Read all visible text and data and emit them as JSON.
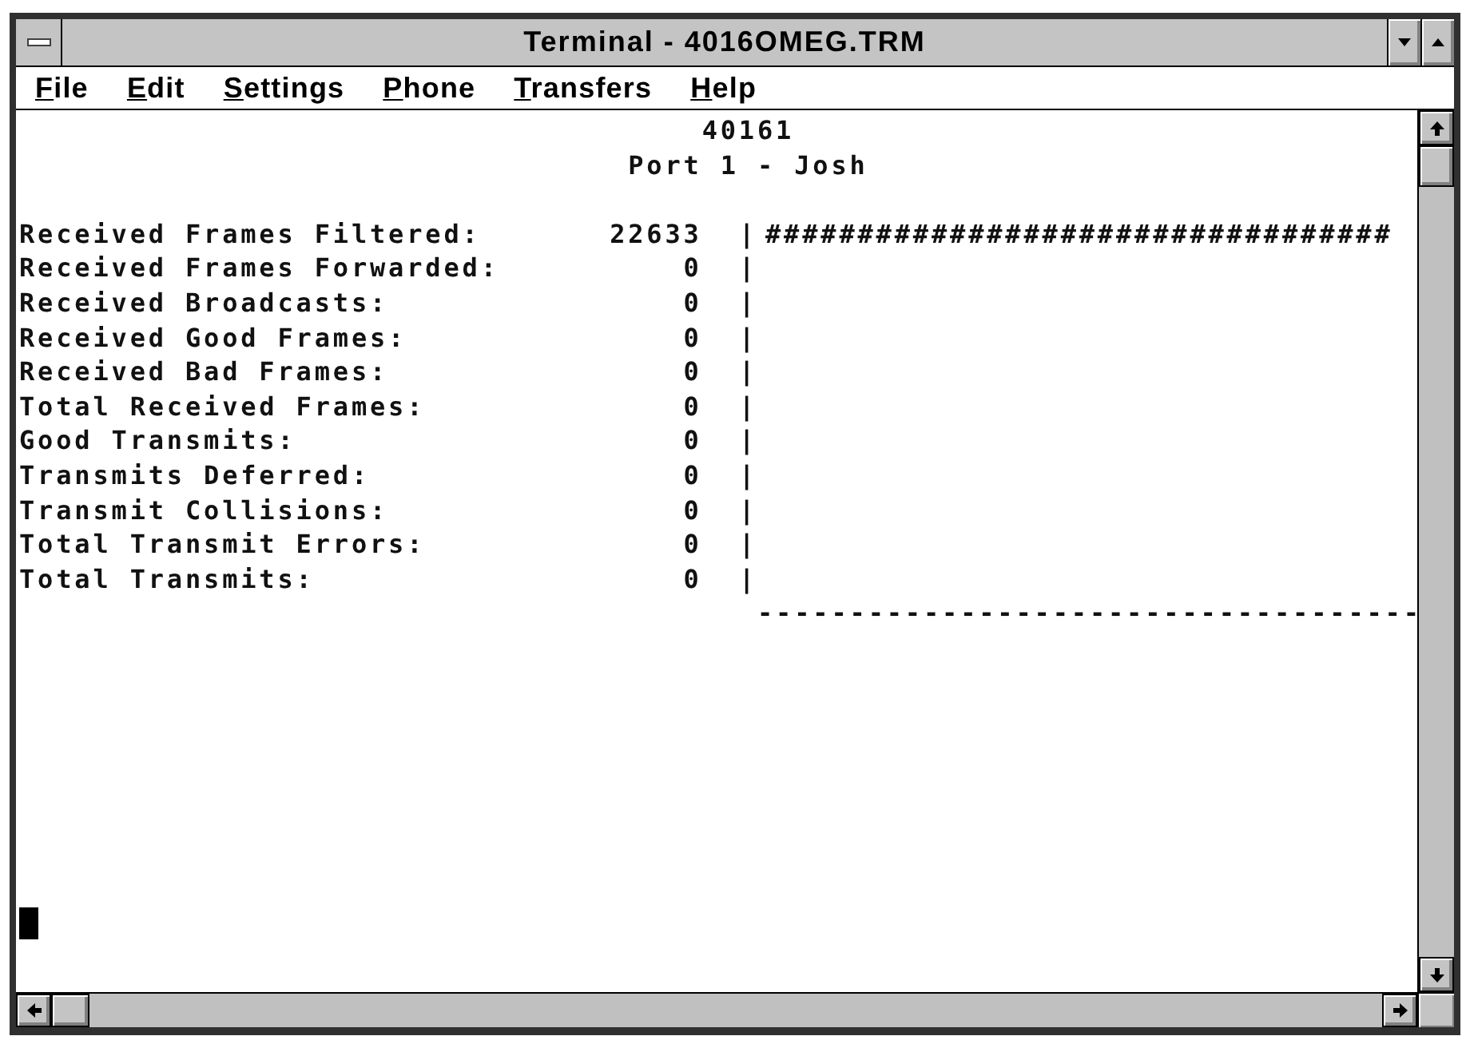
{
  "window": {
    "title": "Terminal - 4016OMEG.TRM"
  },
  "menu_bar": [
    {
      "label": "File"
    },
    {
      "label": "Edit"
    },
    {
      "label": "Settings"
    },
    {
      "label": "Phone"
    },
    {
      "label": "Transfers"
    },
    {
      "label": "Help"
    }
  ],
  "terminal": {
    "header": [
      "40161",
      "Port 1 - Josh"
    ],
    "rows": [
      {
        "label": "Received Frames Filtered:",
        "value": "22633",
        "divider": "|",
        "bar": "##################################"
      },
      {
        "label": "Received Frames Forwarded:",
        "value": "0",
        "divider": "|"
      },
      {
        "label": "Received Broadcasts:",
        "value": "0",
        "divider": "|"
      },
      {
        "label": "Received Good Frames:",
        "value": "0",
        "divider": "|"
      },
      {
        "label": "Received Bad Frames:",
        "value": "0",
        "divider": "|"
      },
      {
        "label": "Total Received Frames:",
        "value": "0",
        "divider": "|"
      },
      {
        "label": "Good Transmits:",
        "value": "0",
        "divider": "|"
      },
      {
        "label": "Transmits Deferred:",
        "value": "0",
        "divider": "|"
      },
      {
        "label": "Transmit Collisions:",
        "value": "0",
        "divider": "|"
      },
      {
        "label": "Total Transmit Errors:",
        "value": "0",
        "divider": "|"
      },
      {
        "label": "Total Transmits:",
        "value": "0",
        "divider": "|"
      }
    ],
    "baseline": "------------------------------------",
    "cursor": true
  }
}
